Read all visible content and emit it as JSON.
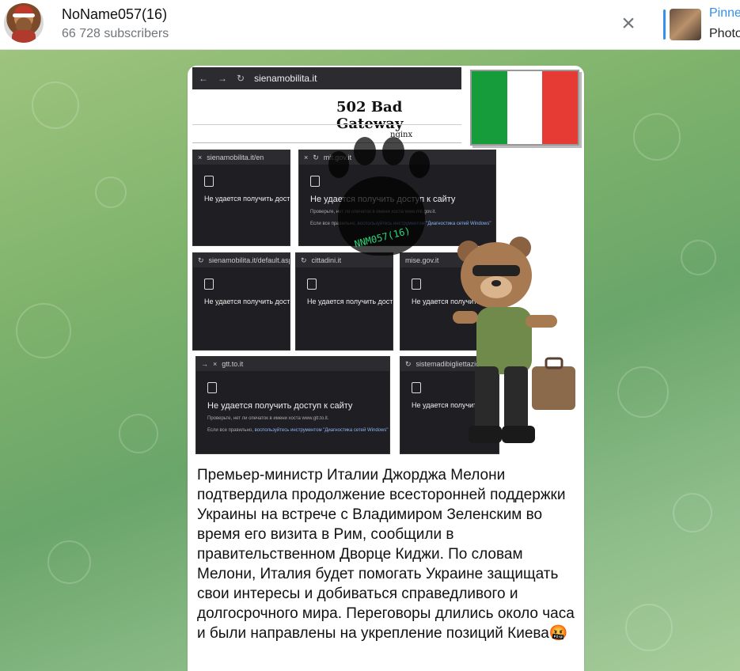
{
  "header": {
    "channel_name": "NoName057(16)",
    "subscribers": "66 728 subscribers",
    "pinned_title": "Pinne",
    "pinned_text": "Photo"
  },
  "media": {
    "gateway_url": "sienamobilita.it",
    "gateway_title": "502 Bad Gateway",
    "gateway_server": "nginx",
    "error_title": "Не удается получить доступ к сайту",
    "paw_label": "NNM057(16)",
    "shots": [
      {
        "url": "sienamobilita.it/en"
      },
      {
        "url": "mit.gov.it",
        "sub1": "Проверьте, нет ли опечаток в имени хоста www.mit.gov.it.",
        "sub2_prefix": "Если все правильно, ",
        "sub2_link": "воспользуйтесь инструментом \"Диагностика сетей Windows\""
      },
      {
        "url": "sienamobilita.it/default.aspx"
      },
      {
        "url": "cittadini.it"
      },
      {
        "url": "mise.gov.it"
      },
      {
        "url": "gtt.to.it",
        "sub1": "Проверьте, нет ли опечаток в имени хоста www.gtt.to.it.",
        "sub2_prefix": "Если все правильно, ",
        "sub2_link": "воспользуйтесь инструментом \"Диагностика сетей Windows\""
      },
      {
        "url": "sistemadibigliettazione.it"
      }
    ],
    "flag_colors": [
      "#179c3c",
      "#ffffff",
      "#e63b35"
    ]
  },
  "message": {
    "text": "Премьер-министр Италии Джорджа Мелони подтвердила продолжение всесторонней поддержки Украины на встрече с Владимиром Зеленским во время его визита в Рим, сообщили в правительственном Дворце Киджи. По словам Мелони, Италия будет помогать Украине защищать свои интересы и добиваться справедливого и долгосрочного мира. Переговоры длились около часа и были направлены на укрепление позиций Киева🤬"
  },
  "colors": {
    "accent": "#3390ec",
    "subtitle": "#707579"
  },
  "icons": {
    "close": "close-icon",
    "back": "back-arrow-icon",
    "forward": "forward-arrow-icon",
    "reload": "reload-icon",
    "document": "document-icon"
  }
}
